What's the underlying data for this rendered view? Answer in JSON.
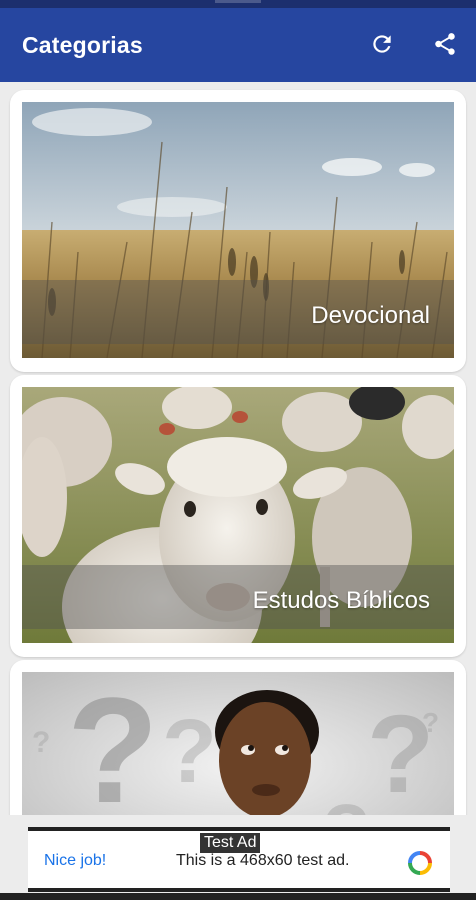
{
  "app_bar": {
    "title": "Categorias",
    "actions": [
      {
        "icon": "refresh-icon"
      },
      {
        "icon": "share-icon"
      }
    ]
  },
  "categories": [
    {
      "label": "Devocional",
      "image": "wheat-field-photo"
    },
    {
      "label": "Estudos Bíblicos",
      "image": "sheep-photo"
    },
    {
      "label": "",
      "image": "thinking-man-question-marks-photo"
    }
  ],
  "ad": {
    "tag": "Test Ad",
    "cta": "Nice job!",
    "text": "This is a 468x60 test ad.",
    "logo_icon": "google-ads-logo-icon"
  },
  "colors": {
    "app_bar": "#2646a0",
    "background": "#ececec",
    "cta": "#1a73e8"
  }
}
